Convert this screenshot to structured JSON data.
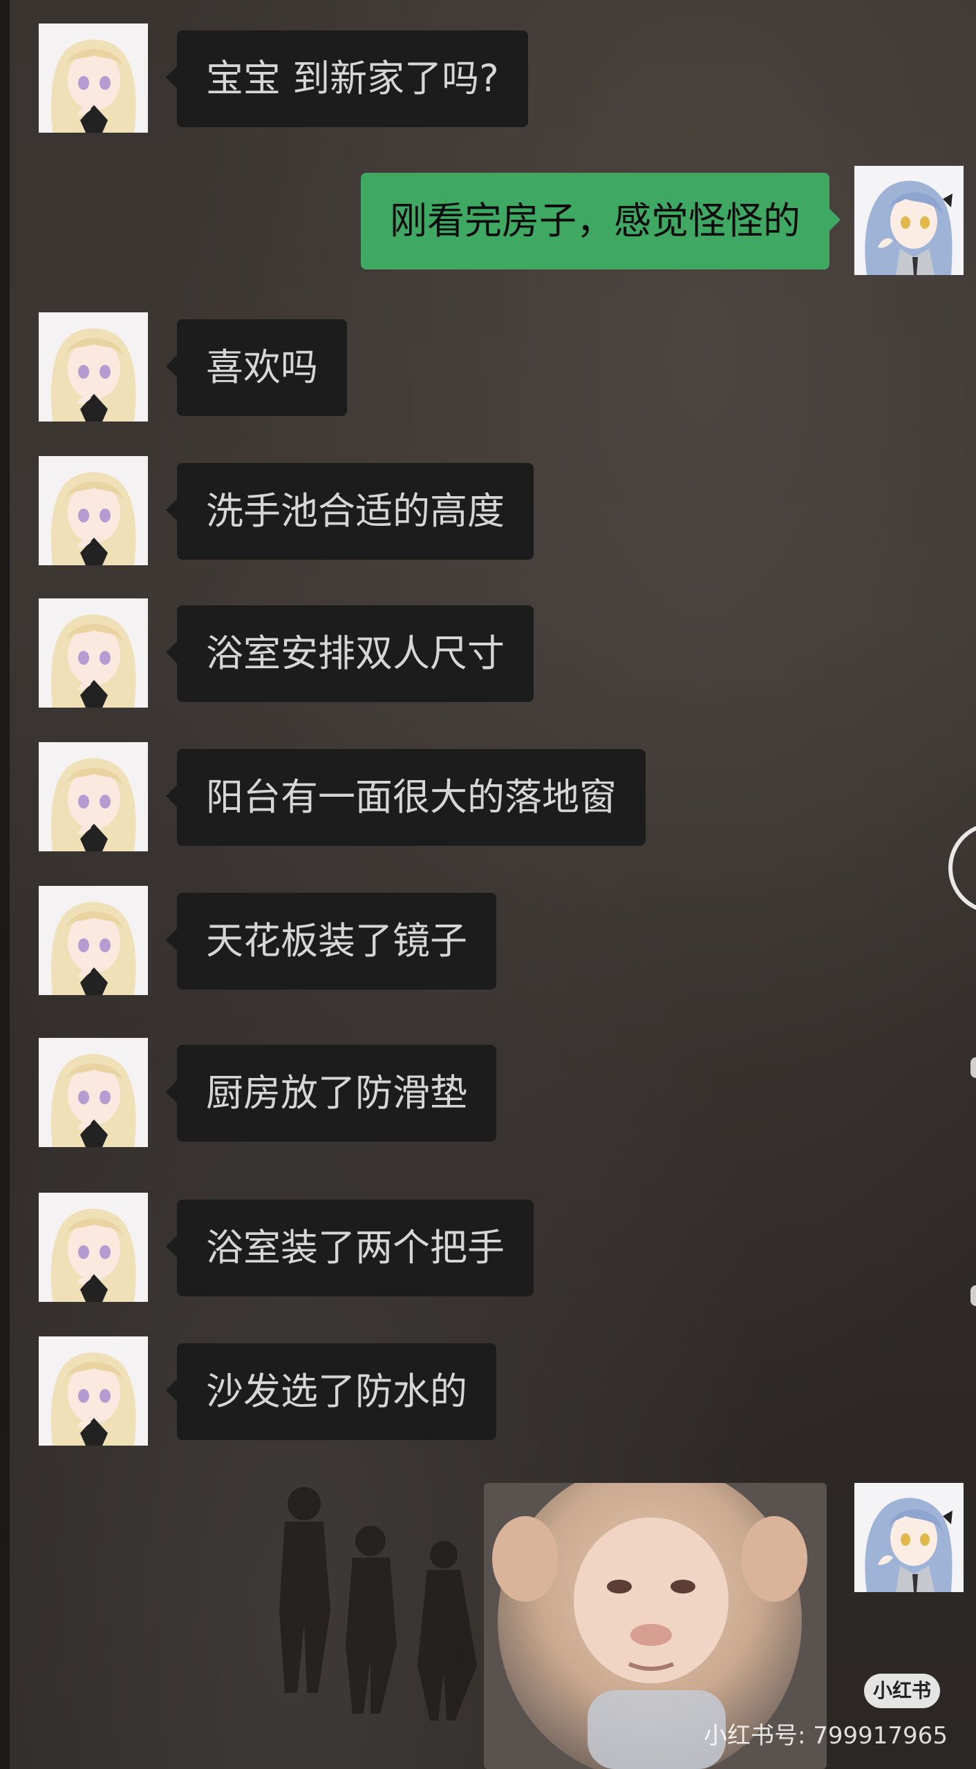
{
  "chat": {
    "messages": [
      {
        "side": "left",
        "text": "宝宝 到新家了吗?"
      },
      {
        "side": "right",
        "text": "刚看完房子，感觉怪怪的"
      },
      {
        "side": "left",
        "text": "喜欢吗"
      },
      {
        "side": "left",
        "text": "洗手池合适的高度"
      },
      {
        "side": "left",
        "text": "浴室安排双人尺寸"
      },
      {
        "side": "left",
        "text": "阳台有一面很大的落地窗"
      },
      {
        "side": "left",
        "text": "天花板装了镜子"
      },
      {
        "side": "left",
        "text": "厨房放了防滑垫"
      },
      {
        "side": "left",
        "text": "浴室装了两个把手"
      },
      {
        "side": "left",
        "text": "沙发选了防水的"
      },
      {
        "side": "right",
        "type": "image",
        "image": "monkey-sticker"
      }
    ]
  },
  "watermark": {
    "logo_text": "小红书",
    "id_text": "小红书号: 799917965"
  },
  "colors": {
    "received_bubble": "#1c1c1c",
    "sent_bubble": "#3fa963",
    "background": "#3a3431"
  }
}
